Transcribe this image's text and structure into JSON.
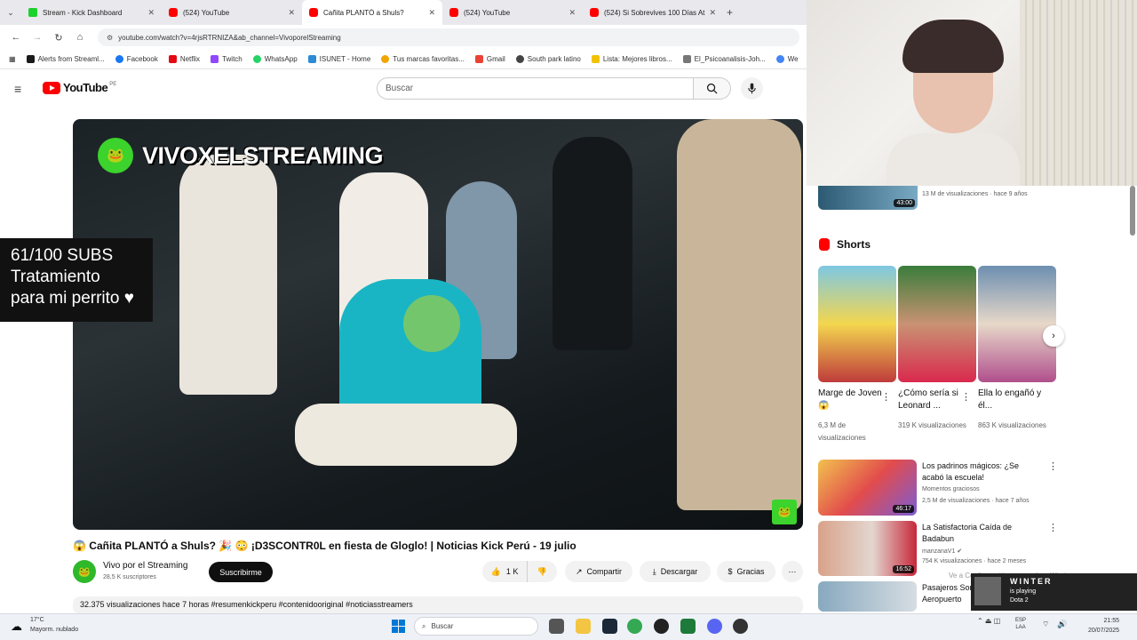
{
  "tabs": [
    {
      "title": "Stream - Kick Dashboard",
      "favicon": "kick-icon",
      "active": false
    },
    {
      "title": "(524) YouTube",
      "favicon": "youtube-icon",
      "active": false
    },
    {
      "title": "Cañita PLANTÓ a Shuls?",
      "favicon": "youtube-icon",
      "active": true
    },
    {
      "title": "(524) YouTube",
      "favicon": "youtube-icon",
      "active": false
    },
    {
      "title": "(524) Si Sobrevives 100 Días At",
      "favicon": "youtube-icon",
      "active": false
    }
  ],
  "address": {
    "url": "youtube.com/watch?v=4rjsRTRNIZA&ab_channel=VivoporelStreaming"
  },
  "bookmarks": [
    "Alerts from Streaml...",
    "Facebook",
    "Netflix",
    "Twitch",
    "WhatsApp",
    "ISUNET - Home",
    "Tus marcas favoritas...",
    "Gmail",
    "South park latino",
    "Lista: Mejores libros...",
    "El_Psicoanalisis-Joh...",
    "We"
  ],
  "youtube": {
    "logo": "YouTube",
    "region": "PE",
    "search_placeholder": "Buscar"
  },
  "video": {
    "watermark": "VIVOXELSTREAMING",
    "title": "😱 Cañita PLANTÓ a Shuls? 🎉 😳 ¡D3SCONTR0L en fiesta de Gloglo! | Noticias Kick Perú - 19 julio",
    "channel": "Vivo por el Streaming",
    "subscribers": "28,5 K suscriptores",
    "subscribe_label": "Suscribirme",
    "likes": "1 K",
    "share_label": "Compartir",
    "download_label": "Descargar",
    "thanks_label": "Gracias",
    "description": "32.375 visualizaciones hace 7 horas #resumenkickperu #contenidooriginal #noticiasstreamers"
  },
  "overlay": {
    "line1": "61/100 SUBS",
    "line2": "Tratamiento",
    "line3": "para mi perrito ♥"
  },
  "sidebar": {
    "top_item": {
      "duration": "43:00",
      "meta": "13 M de visualizaciones · hace 9 años"
    },
    "shorts_title": "Shorts",
    "shorts": [
      {
        "title": "Marge de Joven 😱",
        "views": "6,3 M de visualizaciones"
      },
      {
        "title": "¿Cómo sería si Leonard ...",
        "views": "319 K visualizaciones"
      },
      {
        "title": "Ella lo engañó y él...",
        "views": "863 K visualizaciones"
      }
    ],
    "videos": [
      {
        "title": "Los padrinos mágicos: ¿Se acabó la escuela!",
        "channel": "Momentos graciosos",
        "meta": "2,5 M de visualizaciones · hace 7 años",
        "duration": "46:17"
      },
      {
        "title": "La Satisfactoria Caída de Badabun",
        "channel": "manzanaV1 ✔",
        "meta": "754 K visualizaciones · hace 2 meses",
        "duration": "16:52"
      },
      {
        "title": "Pasajeros Sorprendidos Cuando Aeropuerto",
        "channel": "",
        "meta": "",
        "duration": ""
      }
    ]
  },
  "system_notice": "Ve a Configuración para activar Windows.",
  "twitch_popup": {
    "name": "WINTER",
    "status": "is playing",
    "game": "Dota 2"
  },
  "taskbar": {
    "temperature": "17°C",
    "condition": "Mayorm. nublado",
    "search_label": "Buscar",
    "lang_line1": "ESP",
    "lang_line2": "LAA",
    "time": "21:55",
    "date": "20/07/2025"
  }
}
